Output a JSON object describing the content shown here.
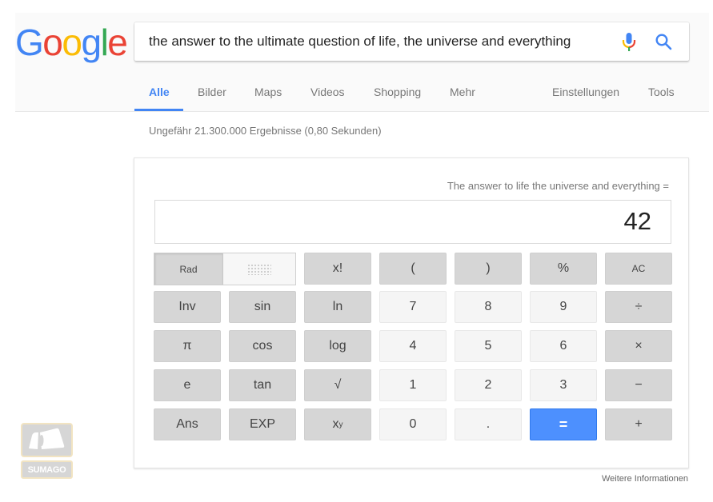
{
  "logo": {
    "text": "Google",
    "letters": [
      {
        "char": "G",
        "color": "#4285f4"
      },
      {
        "char": "o",
        "color": "#ea4335"
      },
      {
        "char": "o",
        "color": "#fbbc05"
      },
      {
        "char": "g",
        "color": "#4285f4"
      },
      {
        "char": "l",
        "color": "#34a853"
      },
      {
        "char": "e",
        "color": "#ea4335"
      }
    ]
  },
  "search": {
    "query": "the answer to the ultimate question of life, the universe and everything",
    "mic_icon": "microphone-icon",
    "search_icon": "magnifier-icon"
  },
  "tabs": [
    {
      "label": "Alle",
      "active": true
    },
    {
      "label": "Bilder",
      "active": false
    },
    {
      "label": "Maps",
      "active": false
    },
    {
      "label": "Videos",
      "active": false
    },
    {
      "label": "Shopping",
      "active": false
    },
    {
      "label": "Mehr",
      "active": false
    }
  ],
  "tools": [
    {
      "label": "Einstellungen"
    },
    {
      "label": "Tools"
    }
  ],
  "result_stats": "Ungefähr 21.300.000 Ergebnisse (0,80 Sekunden)",
  "calculator": {
    "expression": "The answer to life the universe and everything =",
    "display_value": "42",
    "angle_mode": {
      "selected": "Rad",
      "other_icon": "deg-dots-icon"
    },
    "rows": [
      [
        {
          "label": "x!",
          "style": "dark"
        },
        {
          "label": "(",
          "style": "dark"
        },
        {
          "label": ")",
          "style": "dark"
        },
        {
          "label": "%",
          "style": "dark"
        },
        {
          "label": "AC",
          "style": "dark"
        }
      ],
      [
        {
          "label": "Inv",
          "style": "dark"
        },
        {
          "label": "sin",
          "style": "dark"
        },
        {
          "label": "ln",
          "style": "dark"
        },
        {
          "label": "7",
          "style": "light"
        },
        {
          "label": "8",
          "style": "light"
        },
        {
          "label": "9",
          "style": "light"
        },
        {
          "label": "÷",
          "style": "dark"
        }
      ],
      [
        {
          "label": "π",
          "style": "dark"
        },
        {
          "label": "cos",
          "style": "dark"
        },
        {
          "label": "log",
          "style": "dark"
        },
        {
          "label": "4",
          "style": "light"
        },
        {
          "label": "5",
          "style": "light"
        },
        {
          "label": "6",
          "style": "light"
        },
        {
          "label": "×",
          "style": "dark"
        }
      ],
      [
        {
          "label": "e",
          "style": "dark"
        },
        {
          "label": "tan",
          "style": "dark"
        },
        {
          "label": "√",
          "style": "dark"
        },
        {
          "label": "1",
          "style": "light"
        },
        {
          "label": "2",
          "style": "light"
        },
        {
          "label": "3",
          "style": "light"
        },
        {
          "label": "−",
          "style": "dark"
        }
      ],
      [
        {
          "label": "Ans",
          "style": "dark"
        },
        {
          "label": "EXP",
          "style": "dark"
        },
        {
          "label": "xʸ",
          "style": "dark"
        },
        {
          "label": "0",
          "style": "light"
        },
        {
          "label": ".",
          "style": "light"
        },
        {
          "label": "=",
          "style": "blue"
        },
        {
          "label": "+",
          "style": "dark"
        }
      ]
    ],
    "accent_color": "#4d90fe"
  },
  "more_info": "Weitere Informationen",
  "watermark": {
    "text": "SUMAGO"
  }
}
